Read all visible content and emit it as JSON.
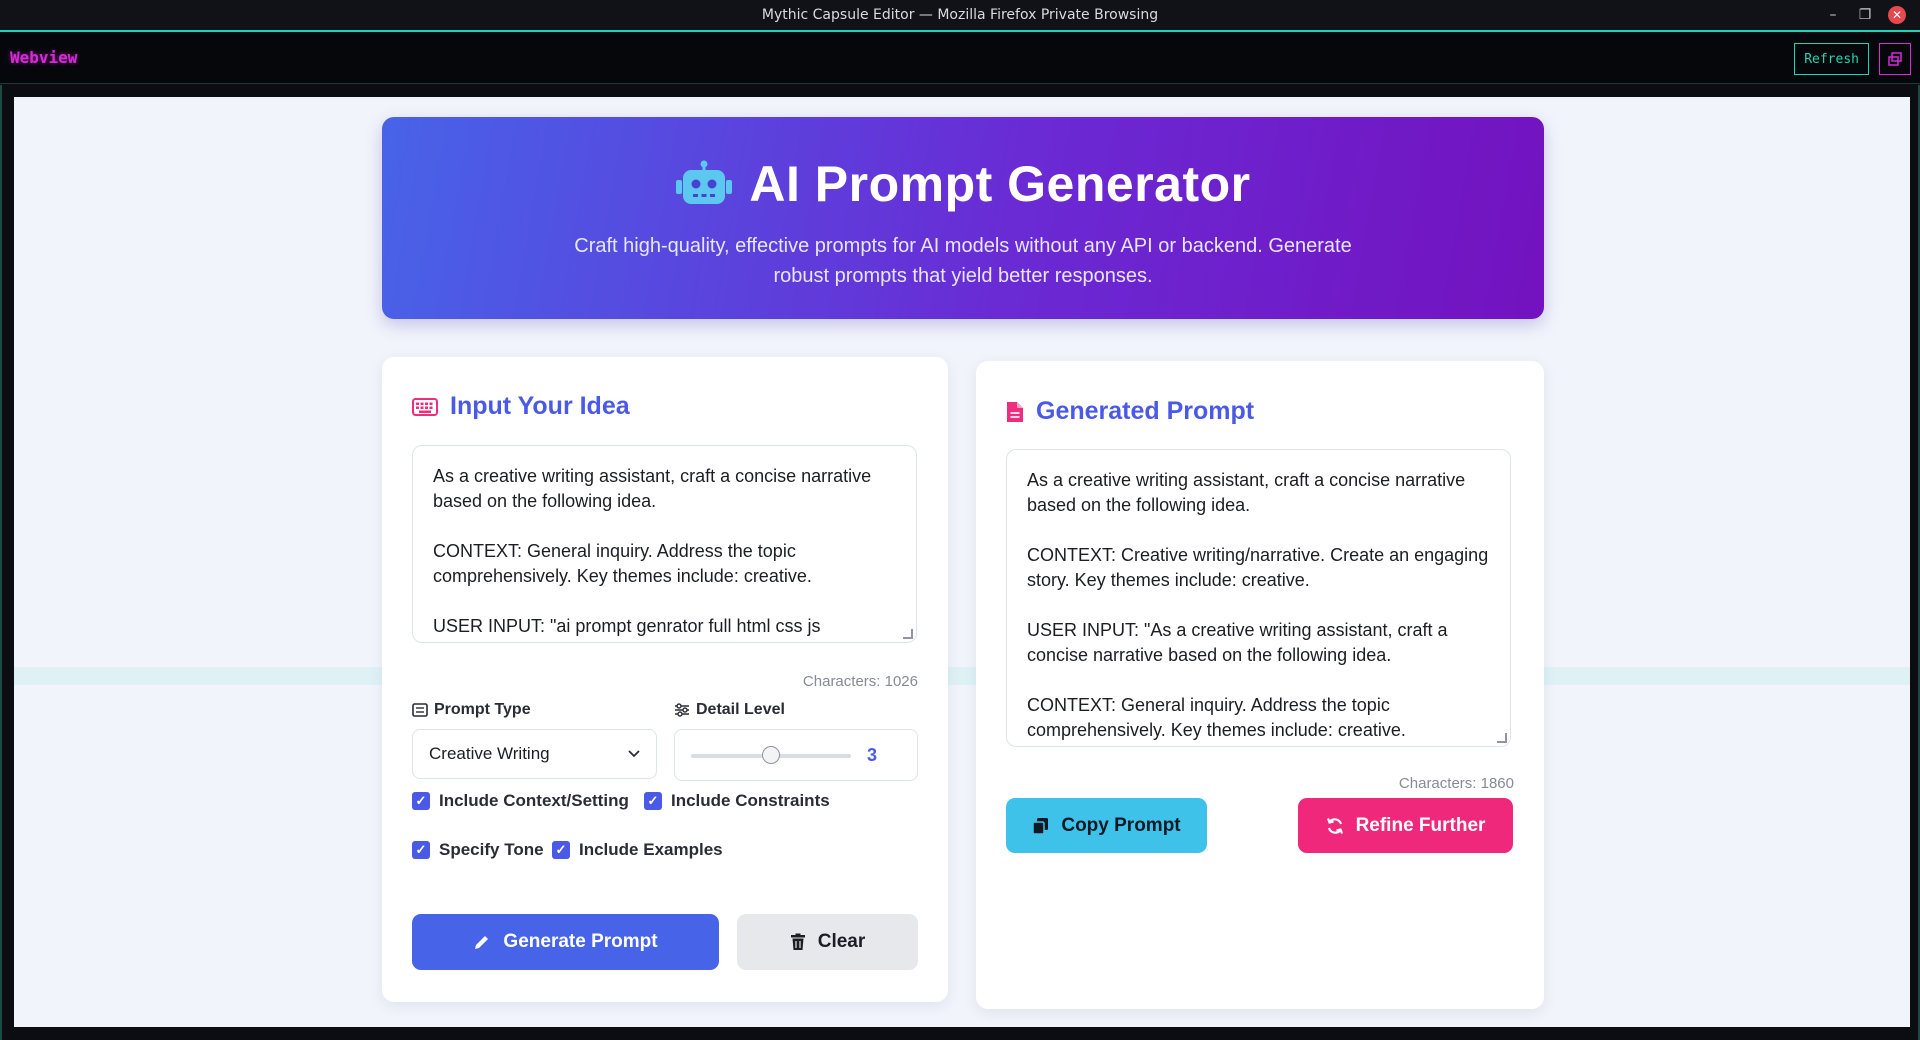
{
  "window": {
    "title": "Mythic Capsule Editor — Mozilla Firefox Private Browsing"
  },
  "toolbar": {
    "label": "Webview",
    "refresh_label": "Refresh"
  },
  "hero": {
    "title": "AI Prompt Generator",
    "subtitle": "Craft high-quality, effective prompts for AI models without any API or backend. Generate robust prompts that yield better responses."
  },
  "input_card": {
    "heading": "Input Your Idea",
    "textarea_value": "As a creative writing assistant, craft a concise narrative based on the following idea.\n\nCONTEXT: General inquiry. Address the topic comprehensively. Key themes include: creative.\n\nUSER INPUT: \"ai prompt genrator full html css js",
    "char_count": "Characters: 1026",
    "prompt_type_label": "Prompt Type",
    "prompt_type_value": "Creative Writing",
    "detail_level_label": "Detail Level",
    "detail_level_value": "3",
    "detail_level_fraction": 0.5,
    "checkboxes": [
      {
        "label": "Include Context/Setting",
        "checked": true
      },
      {
        "label": "Include Constraints",
        "checked": true
      },
      {
        "label": "Specify Tone",
        "checked": true
      },
      {
        "label": "Include Examples",
        "checked": true
      }
    ],
    "generate_label": "Generate Prompt",
    "clear_label": "Clear"
  },
  "output_card": {
    "heading": "Generated Prompt",
    "textarea_value": "As a creative writing assistant, craft a concise narrative based on the following idea.\n\nCONTEXT: Creative writing/narrative. Create an engaging story. Key themes include: creative.\n\nUSER INPUT: \"As a creative writing assistant, craft a concise narrative based on the following idea.\n\nCONTEXT: General inquiry. Address the topic comprehensively. Key themes include: creative.",
    "char_count": "Characters: 1860",
    "copy_label": "Copy Prompt",
    "refine_label": "Refine Further"
  },
  "colors": {
    "accent": "#4a5ae6",
    "pink": "#f0287c",
    "cyan": "#3fc2e9",
    "terminal_green": "#1fd6b4",
    "terminal_magenta": "#d42ad8"
  }
}
